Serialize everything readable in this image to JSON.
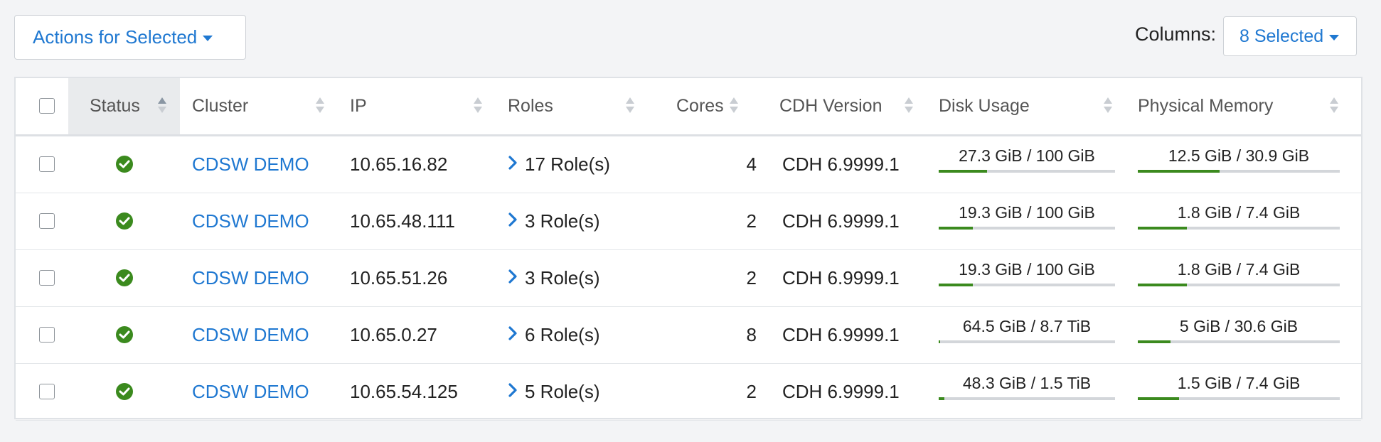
{
  "toolbar": {
    "actions_label": "Actions for Selected",
    "columns_label": "Columns:",
    "columns_value": "8 Selected"
  },
  "table": {
    "headers": {
      "status": "Status",
      "cluster": "Cluster",
      "ip": "IP",
      "roles": "Roles",
      "cores": "Cores",
      "cdh": "CDH Version",
      "disk": "Disk Usage",
      "memory": "Physical Memory"
    },
    "sorted_column": "status",
    "rows": [
      {
        "status": "ok",
        "cluster": "CDSW DEMO",
        "ip": "10.65.16.82",
        "roles": "17 Role(s)",
        "cores": "4",
        "cdh": "CDH 6.9999.1",
        "disk": "27.3 GiB / 100 GiB",
        "disk_pct": 27.3,
        "memory": "12.5 GiB / 30.9 GiB",
        "memory_pct": 40.5
      },
      {
        "status": "ok",
        "cluster": "CDSW DEMO",
        "ip": "10.65.48.111",
        "roles": "3 Role(s)",
        "cores": "2",
        "cdh": "CDH 6.9999.1",
        "disk": "19.3 GiB / 100 GiB",
        "disk_pct": 19.3,
        "memory": "1.8 GiB / 7.4 GiB",
        "memory_pct": 24.3
      },
      {
        "status": "ok",
        "cluster": "CDSW DEMO",
        "ip": "10.65.51.26",
        "roles": "3 Role(s)",
        "cores": "2",
        "cdh": "CDH 6.9999.1",
        "disk": "19.3 GiB / 100 GiB",
        "disk_pct": 19.3,
        "memory": "1.8 GiB / 7.4 GiB",
        "memory_pct": 24.3
      },
      {
        "status": "ok",
        "cluster": "CDSW DEMO",
        "ip": "10.65.0.27",
        "roles": "6 Role(s)",
        "cores": "8",
        "cdh": "CDH 6.9999.1",
        "disk": "64.5 GiB / 8.7 TiB",
        "disk_pct": 0.7,
        "memory": "5 GiB / 30.6 GiB",
        "memory_pct": 16.3
      },
      {
        "status": "ok",
        "cluster": "CDSW DEMO",
        "ip": "10.65.54.125",
        "roles": "5 Role(s)",
        "cores": "2",
        "cdh": "CDH 6.9999.1",
        "disk": "48.3 GiB / 1.5 TiB",
        "disk_pct": 3.1,
        "memory": "1.5 GiB / 7.4 GiB",
        "memory_pct": 20.3
      }
    ]
  },
  "colors": {
    "accent": "#1f78d1",
    "ok_green": "#3b8a1e",
    "track_gray": "#d3d6da"
  },
  "icons": {
    "status_ok": "check-circle-icon",
    "roles_expand": "chevron-right-icon",
    "sort": "sort-arrows-icon",
    "dropdown": "caret-down-icon"
  }
}
